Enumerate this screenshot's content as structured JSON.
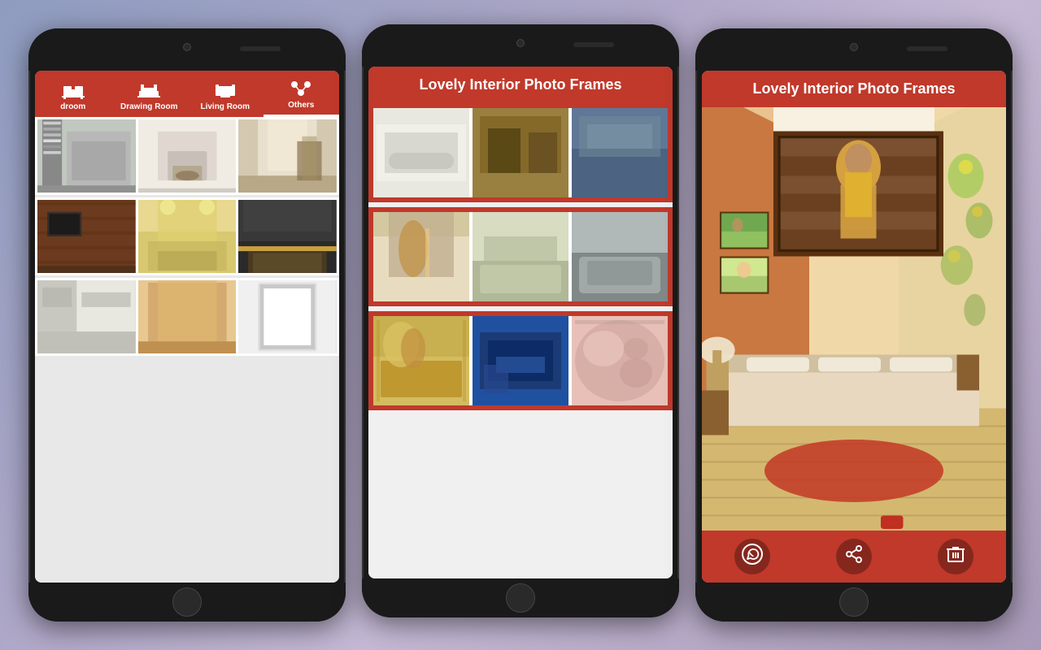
{
  "background": {
    "gradient": "linear-gradient(135deg, #8e9cc0, #b0a8c8, #c4b8d4, #a89ab8)"
  },
  "phone1": {
    "tabs": [
      {
        "id": "bedroom",
        "label": "droom",
        "icon": "bed-icon",
        "active": false
      },
      {
        "id": "drawing-room",
        "label": "Drawing Room",
        "icon": "drawing-room-icon",
        "active": false
      },
      {
        "id": "living-room",
        "label": "Living Room",
        "icon": "living-room-icon",
        "active": false
      },
      {
        "id": "others",
        "label": "Others",
        "icon": "others-icon",
        "active": true
      }
    ],
    "grid_rows": [
      {
        "cells": [
          {
            "type": "bookshelf",
            "color": "#b0b8b0"
          },
          {
            "type": "fireplace",
            "color": "#e8e4e0"
          },
          {
            "type": "hallway",
            "color": "#c8c0a8"
          }
        ]
      },
      {
        "cells": [
          {
            "type": "wood-wall",
            "color": "#7a4020"
          },
          {
            "type": "bright-ceiling",
            "color": "#d8c870"
          },
          {
            "type": "conference",
            "color": "#383838"
          }
        ]
      },
      {
        "cells": [
          {
            "type": "modern-light",
            "color": "#d8d8d0"
          },
          {
            "type": "warm-hall",
            "color": "#d4aa70"
          },
          {
            "type": "frame-white",
            "color": "#e8e8e8"
          }
        ]
      }
    ]
  },
  "phone2": {
    "header_title": "Lovely Interior Photo Frames",
    "sections": [
      {
        "photos": [
          {
            "type": "white-bed",
            "color": "#e8e8e0"
          },
          {
            "type": "brown-bedroom",
            "color": "#8B7030"
          },
          {
            "type": "blue-bedroom",
            "color": "#4a6080"
          }
        ]
      },
      {
        "photos": [
          {
            "type": "art-girl",
            "color": "#c8b890"
          },
          {
            "type": "living-room",
            "color": "#c0c8a8"
          },
          {
            "type": "gray-sofa",
            "color": "#909898"
          }
        ]
      },
      {
        "photos": [
          {
            "type": "gold-frame-girl",
            "color": "#c8b050"
          },
          {
            "type": "blue-dresser",
            "color": "#1a4080"
          },
          {
            "type": "floral-girl",
            "color": "#d8b0a8"
          }
        ]
      }
    ]
  },
  "phone3": {
    "header_title": "Lovely Interior Photo Frames",
    "main_image": {
      "type": "bedroom-with-frame",
      "description": "Orange warm bedroom with large framed portrait on wood wall",
      "bg_color": "#d4a870"
    },
    "toolbar": {
      "buttons": [
        {
          "id": "whatsapp",
          "icon": "whatsapp-icon",
          "label": "WhatsApp"
        },
        {
          "id": "share",
          "icon": "share-icon",
          "label": "Share"
        },
        {
          "id": "delete",
          "icon": "delete-icon",
          "label": "Delete"
        }
      ]
    }
  }
}
